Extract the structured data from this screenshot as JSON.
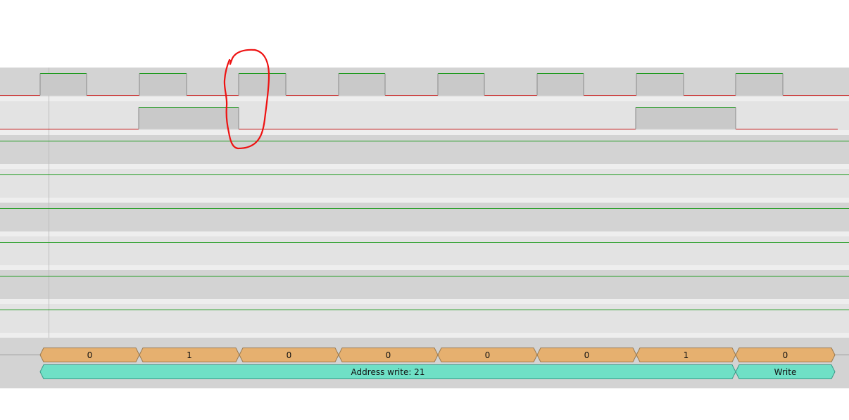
{
  "colors": {
    "page": "#ffffff",
    "lane_dark": "#d3d3d3",
    "lane_light": "#e3e3e3",
    "separator": "#ececec",
    "signal_high": "#1c9a1c",
    "signal_low": "#cc1c1c",
    "pulse_fill": "#c9c9c9",
    "edge": "#8a8a8a",
    "bit_fill": "#e6b06f",
    "bit_stroke": "#9a7a50",
    "frame_fill": "#6fe0c6",
    "frame_stroke": "#3b9a88",
    "annotation": "#ee1111"
  },
  "channels": [
    {
      "id": "scl",
      "levels": [
        0,
        1,
        0,
        1,
        0,
        1,
        0,
        1,
        0,
        1,
        0,
        1,
        0,
        1,
        0,
        1,
        0
      ]
    },
    {
      "id": "sda",
      "levels": [
        0,
        1,
        0,
        1,
        0
      ]
    },
    {
      "id": "ch2",
      "levels": [
        1
      ]
    },
    {
      "id": "ch3",
      "levels": [
        1
      ]
    },
    {
      "id": "ch4",
      "levels": [
        1
      ]
    },
    {
      "id": "ch5",
      "levels": [
        1
      ]
    },
    {
      "id": "ch6",
      "levels": [
        1
      ]
    },
    {
      "id": "ch7",
      "levels": [
        1
      ]
    }
  ],
  "bits": [
    {
      "label": "0"
    },
    {
      "label": "1"
    },
    {
      "label": "0"
    },
    {
      "label": "0"
    },
    {
      "label": "0"
    },
    {
      "label": "0"
    },
    {
      "label": "1"
    },
    {
      "label": "0"
    }
  ],
  "frames": [
    {
      "label": "Address write: 21"
    },
    {
      "label": "Write"
    }
  ]
}
